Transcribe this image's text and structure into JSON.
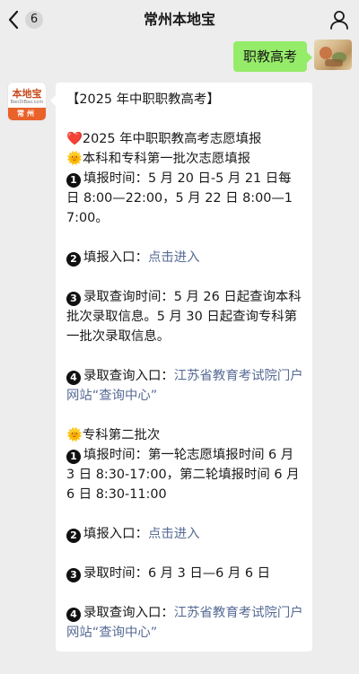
{
  "nav": {
    "unread_count": "6",
    "title": "常州本地宝"
  },
  "outgoing": {
    "text": "职教高考"
  },
  "bot_avatar": {
    "logo": "本地宝",
    "logo_sub": "BenDiBao.com",
    "city": "常州"
  },
  "message": {
    "heading": "【2025 年中职职教高考】",
    "line_heart": "❤️2025 年中职职教高考志愿填报",
    "section1_title": "🌞本科和专科第一批次志愿填报",
    "s1_item1_num": "1",
    "s1_item1": "填报时间：5 月 20 日-5 月 21 日每日 8:00—22:00，5 月 22 日 8:00—17:00。",
    "s1_item2_num": "2",
    "s1_item2_label": "填报入口：",
    "s1_item2_link": "点击进入",
    "s1_item3_num": "3",
    "s1_item3": "录取查询时间：5 月 26 日起查询本科批次录取信息。5 月 30 日起查询专科第一批次录取信息。",
    "s1_item4_num": "4",
    "s1_item4_label": "录取查询入口：",
    "s1_item4_link": "江苏省教育考试院门户网站“查询中心”",
    "section2_title": "🌞专科第二批次",
    "s2_item1_num": "1",
    "s2_item1": "填报时间：第一轮志愿填报时间 6 月 3 日 8:30-17:00，第二轮填报时间 6 月 6 日 8:30-11:00",
    "s2_item2_num": "2",
    "s2_item2_label": "填报入口：",
    "s2_item2_link": "点击进入",
    "s2_item3_num": "3",
    "s2_item3": "录取时间：6 月 3 日—6 月 6 日",
    "s2_item4_num": "4",
    "s2_item4_label": "录取查询入口：",
    "s2_item4_link": "江苏省教育考试院门户网站“查询中心”"
  },
  "colors": {
    "background": "#ededed",
    "outgoing_bubble": "#95ec69",
    "link": "#576b95",
    "brand_orange": "#e8622a"
  },
  "icons": {
    "back": "chevron-left-icon",
    "profile": "person-icon"
  }
}
